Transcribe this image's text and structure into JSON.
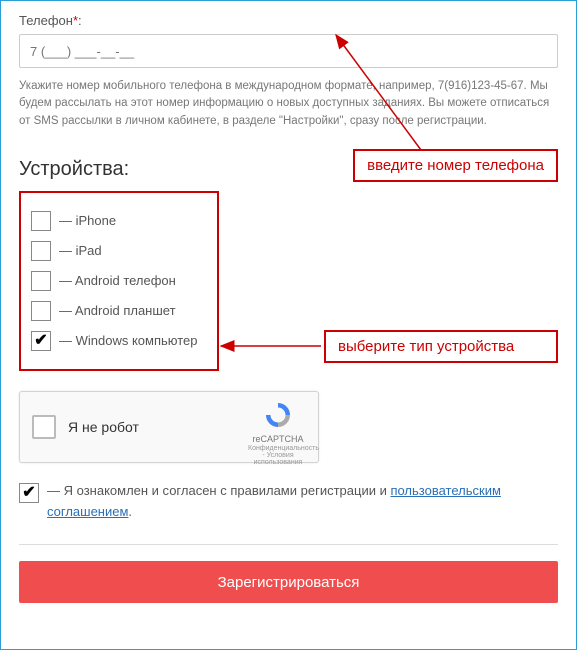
{
  "phone": {
    "label": "Телефон",
    "required_mark": "*",
    "colon": ":",
    "placeholder": "7 (___) ___-__-__",
    "help": "Укажите номер мобильного телефона в международном формате, например, 7(916)123-45-67. Мы будем рассылать на этот номер информацию о новых доступных заданиях. Вы можете отписаться от SMS рассылки в личном кабинете, в разделе \"Настройки\", сразу после регистрации."
  },
  "devices": {
    "title": "Устройства:",
    "items": [
      {
        "label": "— iPhone",
        "checked": false
      },
      {
        "label": "— iPad",
        "checked": false
      },
      {
        "label": "— Android телефон",
        "checked": false
      },
      {
        "label": "— Android планшет",
        "checked": false
      },
      {
        "label": "— Windows компьютер",
        "checked": true
      }
    ]
  },
  "callouts": {
    "phone": "введите номер телефона",
    "device": "выберите тип устройства"
  },
  "captcha": {
    "label": "Я не робот",
    "brand": "reCAPTCHA",
    "terms": "Конфиденциальность - Условия использования"
  },
  "agree": {
    "prefix": "— Я ознакомлен и согласен с правилами регистрации и ",
    "link": "пользовательским соглашением",
    "suffix": ".",
    "checked": true
  },
  "submit": "Зарегистрироваться",
  "colors": {
    "accent_red": "#c00",
    "button_red": "#f04e4e",
    "link_blue": "#2a6fb5",
    "border_blue": "#2a9fd6"
  }
}
